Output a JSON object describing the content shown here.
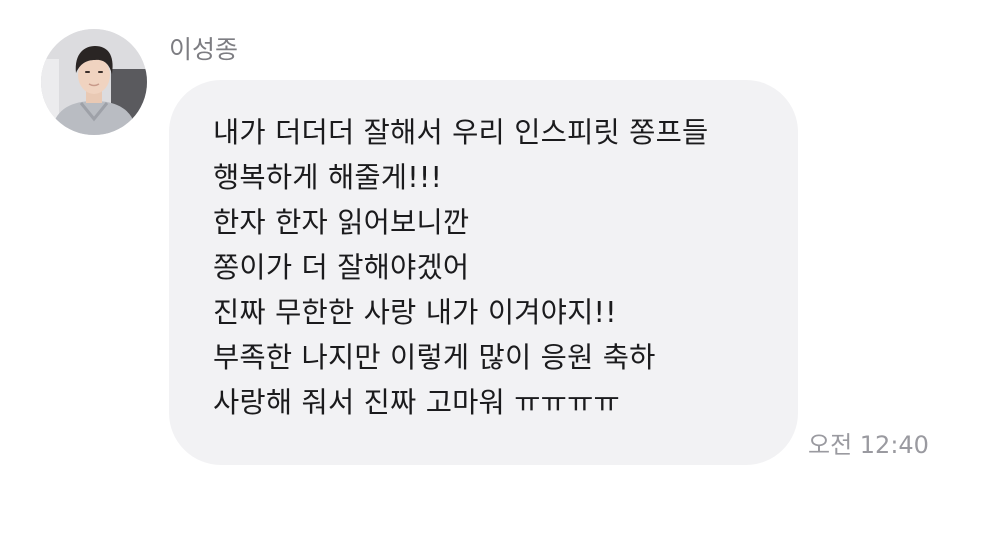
{
  "message": {
    "sender": "이성종",
    "lines": [
      "내가 더더더 잘해서 우리 인스피릿 쫑프들",
      "행복하게 해줄게!!!",
      "한자 한자 읽어보니깐",
      "쫑이가 더 잘해야겠어",
      "진짜 무한한 사랑 내가 이겨야지!!",
      "부족한 나지만 이렇게 많이 응원 축하",
      "사랑해 줘서 진짜 고마워 ㅠㅠㅠㅠ"
    ],
    "time": "오전 12:40"
  },
  "colors": {
    "bubble": "#f2f2f4",
    "text": "#1b1b1d",
    "sender": "#7d7d82",
    "time": "#9a9aa0"
  }
}
